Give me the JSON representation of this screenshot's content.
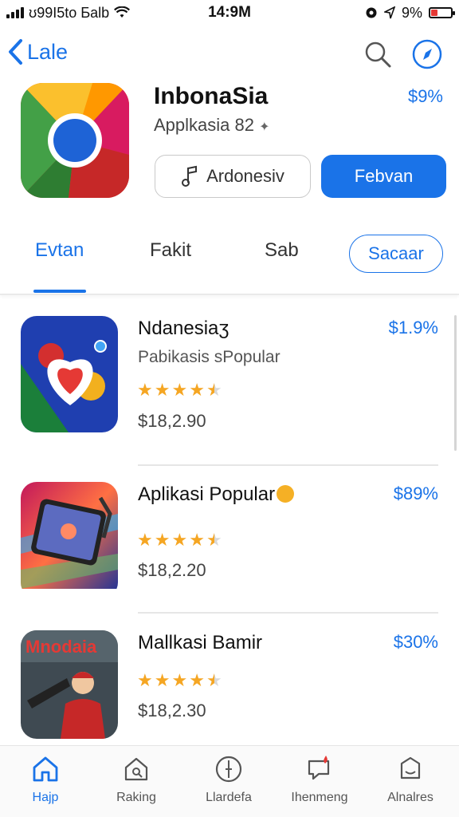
{
  "status_bar": {
    "carrier": "ʊ99I5to Ƃalb",
    "time": "14:9M",
    "battery": "9%",
    "battery_level": 0.35
  },
  "nav": {
    "back_label": "Lale"
  },
  "app": {
    "name": "InbonaSia",
    "subtitle": "Applkasia 82",
    "price": "$9%",
    "secondary_button": "Ardonesiv",
    "primary_button": "Febvan"
  },
  "tabs": [
    "Evtan",
    "Fakit",
    "Sab"
  ],
  "tab_pill": "Sacaar",
  "list": [
    {
      "title": "Ndanesiaʒ",
      "subtitle": "Pabikasis sPopular",
      "rating": 4.5,
      "amount": "$18,2.90",
      "price": "$1.9%"
    },
    {
      "title": "Aplikasi Popular",
      "subtitle": "",
      "rating": 4.5,
      "amount": "$18,2.20",
      "price": "$89%"
    },
    {
      "title": "Mallkasi Bamir",
      "subtitle": "",
      "rating": 4.5,
      "amount": "$18,2.30",
      "price": "$30%",
      "icon_text": "Mnodaia"
    }
  ],
  "bottom_tabs": [
    "Hajp",
    "Raking",
    "Llardefa",
    "Ihenmeng",
    "Alnalres"
  ],
  "colors": {
    "accent": "#1a73e8",
    "star": "#f5a623",
    "badge_red": "#e53935"
  }
}
